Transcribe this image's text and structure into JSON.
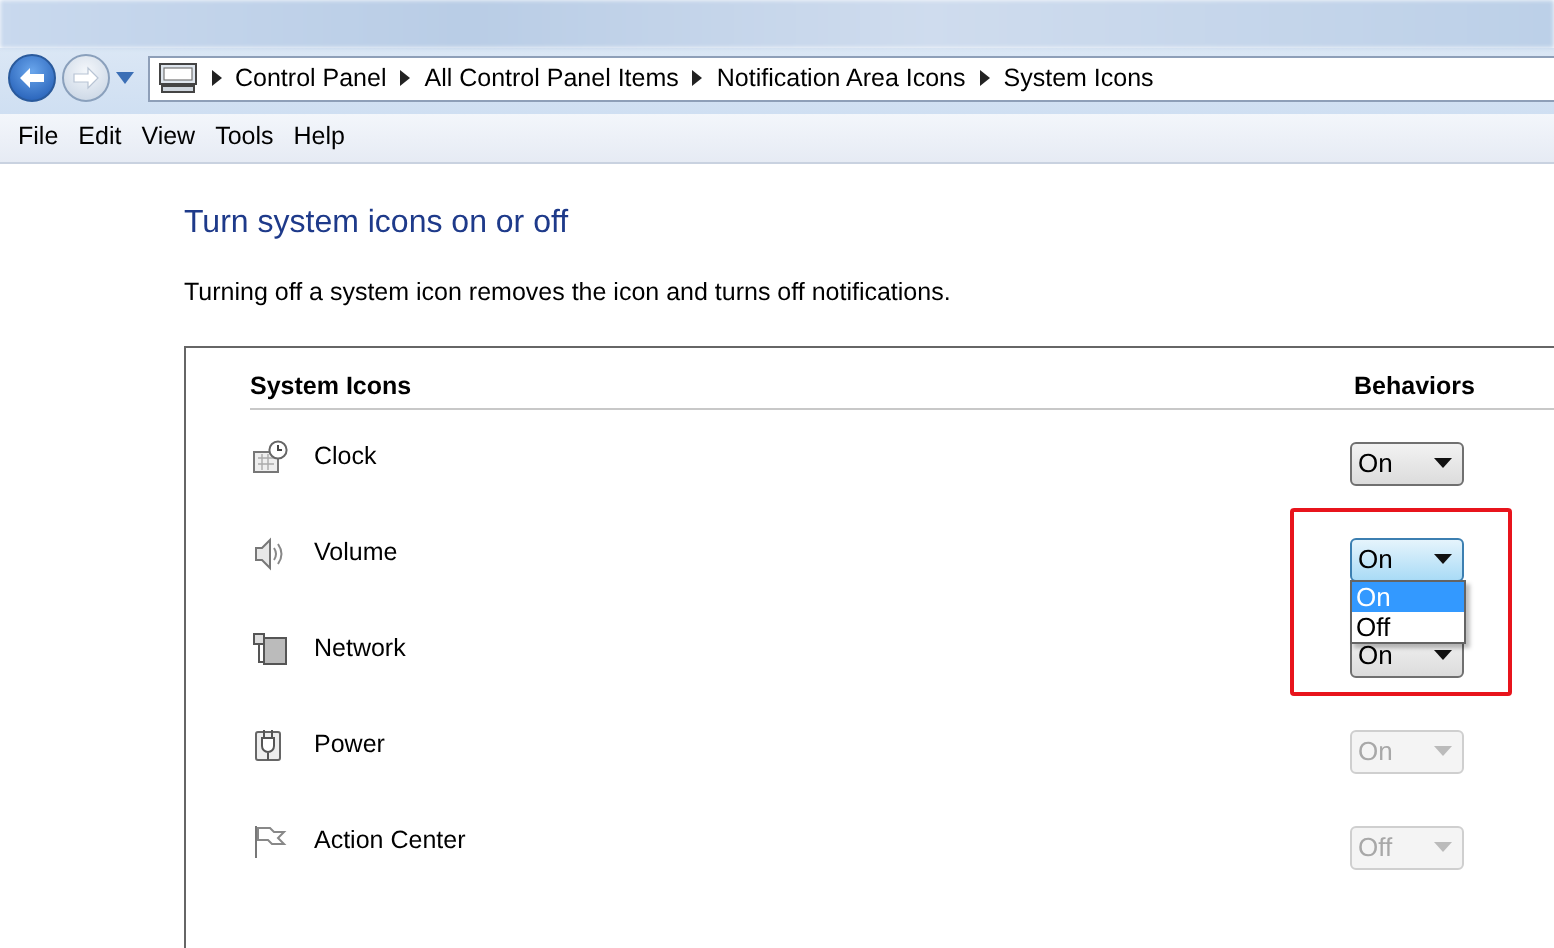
{
  "address_bar": {
    "crumbs": [
      "Control Panel",
      "All Control Panel Items",
      "Notification Area Icons",
      "System Icons"
    ]
  },
  "menu": [
    "File",
    "Edit",
    "View",
    "Tools",
    "Help"
  ],
  "heading": "Turn system icons on or off",
  "description": "Turning off a system icon removes the icon and turns off notifications.",
  "table": {
    "columns": [
      "System Icons",
      "Behaviors"
    ],
    "rows": [
      {
        "name": "Clock",
        "value": "On",
        "disabled": false,
        "expanded": false,
        "highlighted": false
      },
      {
        "name": "Volume",
        "value": "On",
        "disabled": false,
        "expanded": true,
        "highlighted": true,
        "options": [
          {
            "label": "On",
            "selected": true
          },
          {
            "label": "Off",
            "selected": false
          }
        ]
      },
      {
        "name": "Network",
        "value": "On",
        "disabled": false,
        "expanded": false,
        "highlighted": false
      },
      {
        "name": "Power",
        "value": "On",
        "disabled": true,
        "expanded": false,
        "highlighted": false
      },
      {
        "name": "Action Center",
        "value": "Off",
        "disabled": true,
        "expanded": false,
        "highlighted": false
      }
    ]
  }
}
